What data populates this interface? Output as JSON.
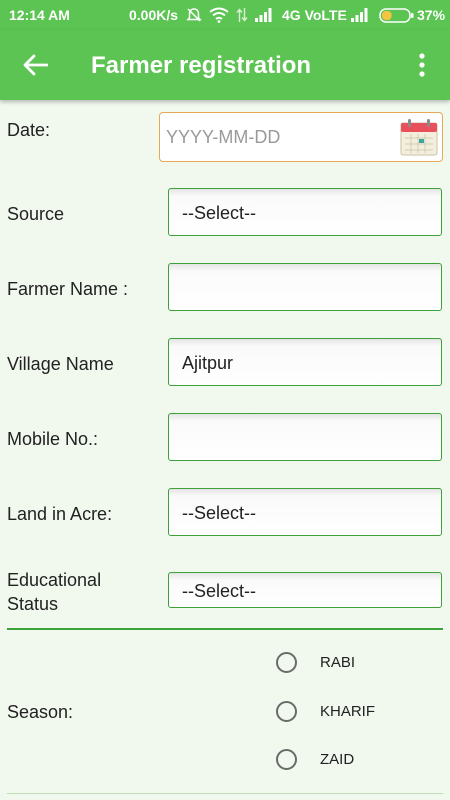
{
  "status_bar": {
    "time": "12:14 AM",
    "speed": "0.00K/s",
    "network": "4G VoLTE",
    "battery": "37%",
    "battery_level": 0.37
  },
  "app_bar": {
    "title": "Farmer registration"
  },
  "form": {
    "date": {
      "label": "Date:",
      "placeholder": "YYYY-MM-DD",
      "value": ""
    },
    "source": {
      "label": "Source",
      "value": "--Select--"
    },
    "farmer_name": {
      "label": "Farmer Name :",
      "value": ""
    },
    "village_name": {
      "label": "Village Name",
      "value": "Ajitpur"
    },
    "mobile": {
      "label": "Mobile No.:",
      "value": ""
    },
    "land": {
      "label": "Land in Acre:",
      "value": "--Select--"
    },
    "education": {
      "label_line1": "Educational",
      "label_line2": "Status",
      "value": "--Select--"
    },
    "season": {
      "label": "Season:",
      "options": [
        "RABI",
        "KHARIF",
        "ZAID"
      ],
      "selected": null
    }
  },
  "colors": {
    "primary": "#5cc453",
    "accent_border": "#3da13a",
    "date_border": "#e8a855",
    "background": "#f1f8ee"
  }
}
